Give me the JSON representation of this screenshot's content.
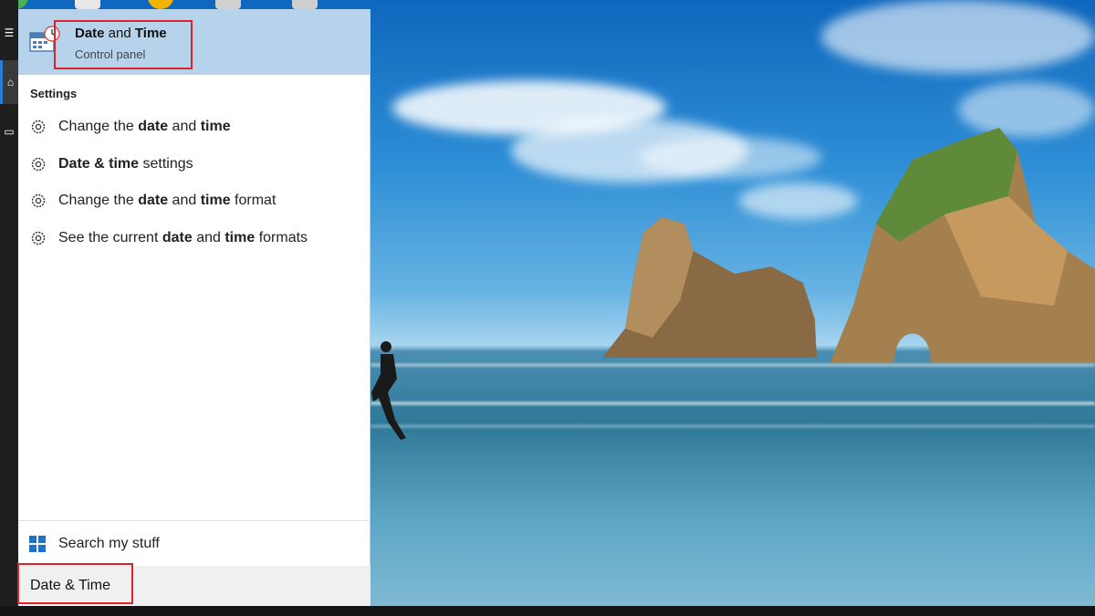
{
  "best_match": {
    "title_part1": "Date",
    "title_part2": " and ",
    "title_part3": "Time",
    "subtitle": "Control panel",
    "icon": "calendar-clock-icon"
  },
  "settings": {
    "section_title": "Settings",
    "items": [
      {
        "parts": [
          "Change the ",
          "date",
          " and ",
          "time",
          ""
        ],
        "icon": "gear-icon"
      },
      {
        "parts": [
          "",
          "Date & time",
          " settings",
          "",
          ""
        ],
        "icon": "gear-icon"
      },
      {
        "parts": [
          "Change the ",
          "date",
          " and ",
          "time",
          " format"
        ],
        "icon": "gear-icon"
      },
      {
        "parts": [
          "See the current ",
          "date",
          " and ",
          "time",
          " formats"
        ],
        "icon": "gear-icon"
      }
    ]
  },
  "search_my_stuff": {
    "label": "Search my stuff",
    "icon": "windows-logo-icon"
  },
  "search_box": {
    "value": "Date & Time"
  },
  "colors": {
    "best_match_bg": "#b7d3ec",
    "highlight_border": "#e0222a",
    "accent": "#1e73c8"
  }
}
